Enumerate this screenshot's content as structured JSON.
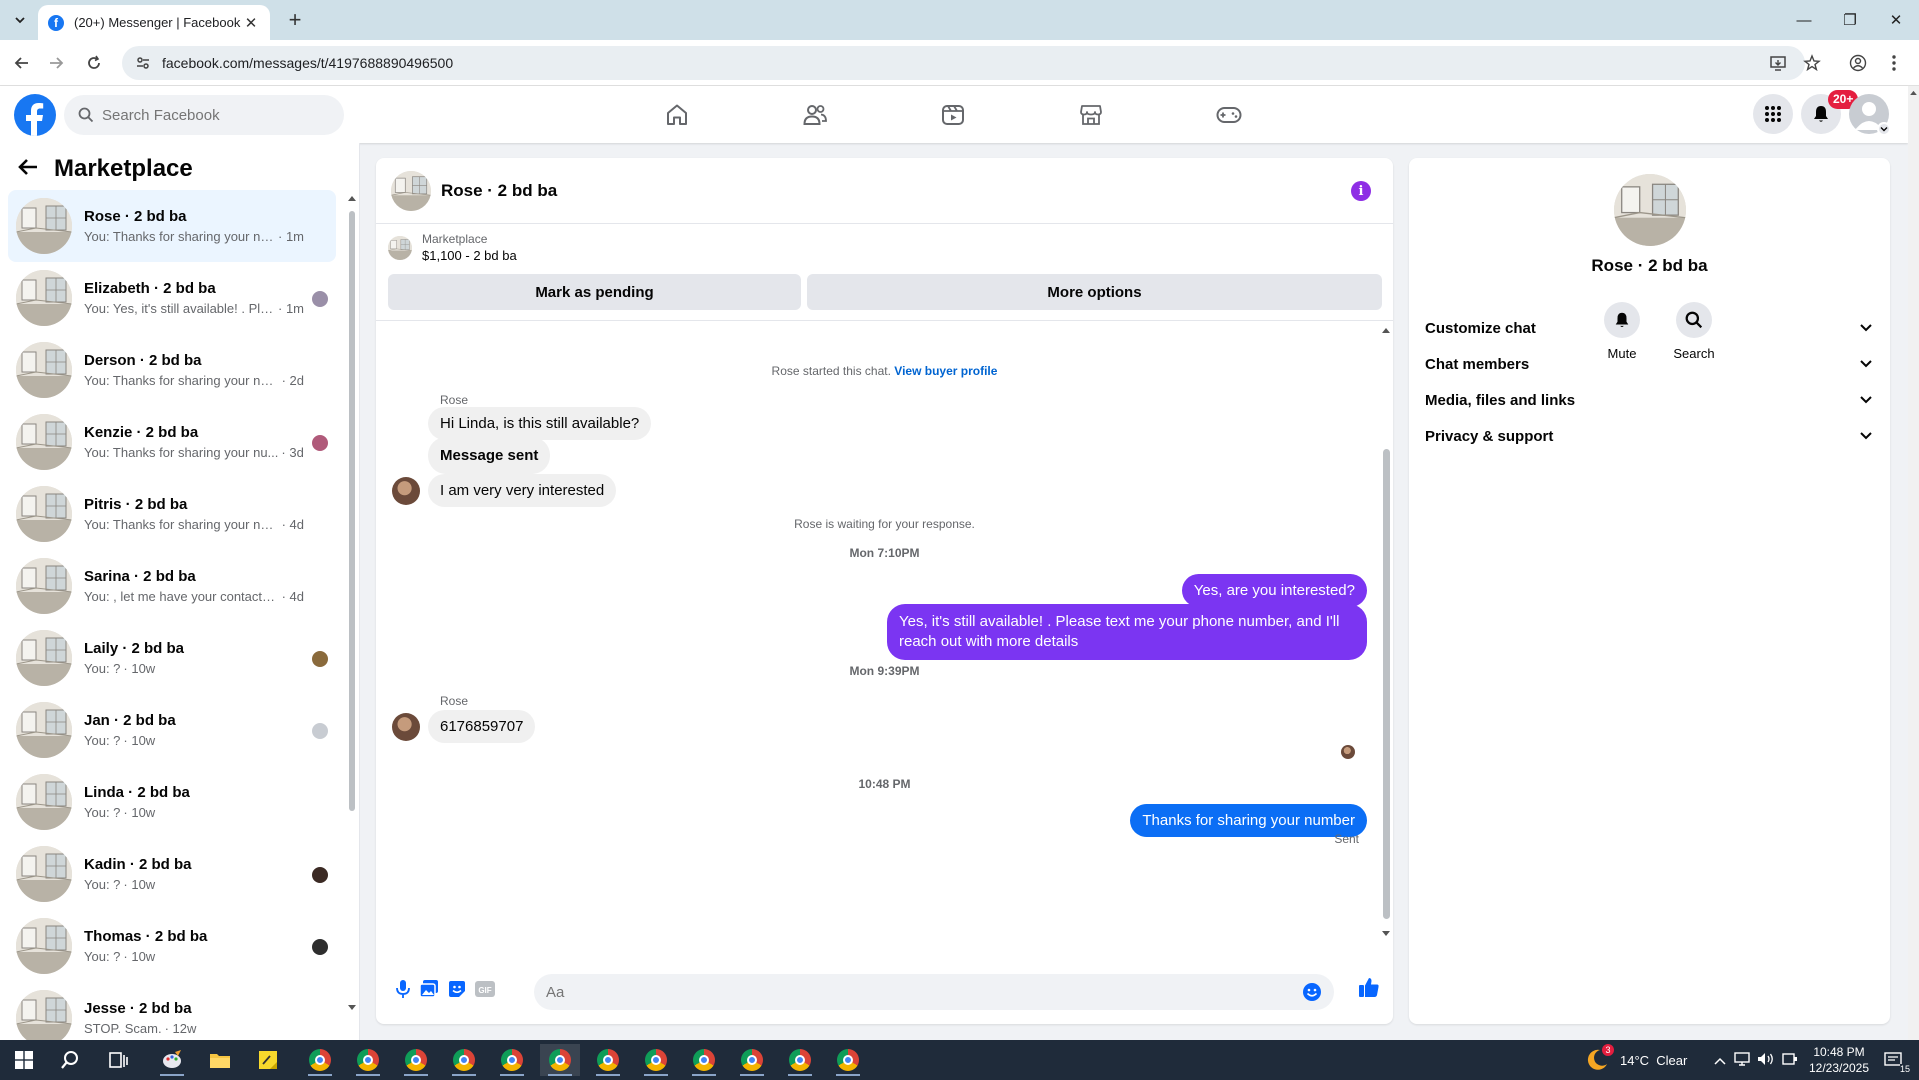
{
  "browser": {
    "tab_title": "(20+) Messenger | Facebook",
    "url": "facebook.com/messages/t/4197688890496500"
  },
  "fb_header": {
    "search_placeholder": "Search Facebook",
    "notification_count": "20+"
  },
  "left_panel": {
    "title": "Marketplace",
    "chats": [
      {
        "name": "Rose · 2 bd ba",
        "preview": "You: Thanks for sharing your num...",
        "time": "· 1m",
        "active": true,
        "mini": ""
      },
      {
        "name": "Elizabeth · 2 bd ba",
        "preview": "You: Yes, it's still available! . Plea...",
        "time": "· 1m",
        "active": false,
        "mini": "#9a8fa8"
      },
      {
        "name": "Derson · 2 bd ba",
        "preview": "You: Thanks for sharing your number",
        "time": "· 2d",
        "active": false,
        "mini": ""
      },
      {
        "name": "Kenzie · 2 bd ba",
        "preview": "You: Thanks for sharing your nu...",
        "time": "· 3d",
        "active": false,
        "mini": "#b05a7a"
      },
      {
        "name": "Pitris · 2 bd ba",
        "preview": "You: Thanks for sharing your number",
        "time": "· 4d",
        "active": false,
        "mini": ""
      },
      {
        "name": "Sarina · 2 bd ba",
        "preview": "You: , let me have your contact nu...",
        "time": "· 4d",
        "active": false,
        "mini": ""
      },
      {
        "name": "Laily · 2 bd ba",
        "preview": "You: ?",
        "time": "· 10w",
        "active": false,
        "mini": "#8a6a3c"
      },
      {
        "name": "Jan · 2 bd ba",
        "preview": "You: ?",
        "time": "· 10w",
        "active": false,
        "mini": "#c8ccd2"
      },
      {
        "name": "Linda · 2 bd ba",
        "preview": "You: ?",
        "time": "· 10w",
        "active": false,
        "mini": ""
      },
      {
        "name": "Kadin · 2 bd ba",
        "preview": "You: ?",
        "time": "· 10w",
        "active": false,
        "mini": "#3b2a24"
      },
      {
        "name": "Thomas · 2 bd ba",
        "preview": "You: ?",
        "time": "· 10w",
        "active": false,
        "mini": "#2e2e2e"
      },
      {
        "name": "Jesse · 2 bd ba",
        "preview": "STOP. Scam.",
        "time": "· 12w",
        "active": false,
        "mini": ""
      }
    ]
  },
  "conversation": {
    "title": "Rose · 2 bd ba",
    "marketplace_label": "Marketplace",
    "listing": "$1,100 - 2 bd ba",
    "mark_pending": "Mark as pending",
    "more_options": "More options",
    "started_text": "Rose started this chat.",
    "view_profile": "View buyer profile",
    "sender_name": "Rose",
    "msg_1": "Hi Linda, is this still available?",
    "msg_2": "Message sent",
    "msg_3": "I am very very interested",
    "waiting": "Rose is waiting for your response.",
    "time_1": "Mon 7:10PM",
    "out_1": "Yes, are you interested?",
    "out_2": "Yes, it's still available! . Please text me your phone number, and I'll reach out with more details",
    "time_2": "Mon 9:39PM",
    "sender_name_2": "Rose",
    "msg_4": "6176859707",
    "time_3": "10:48 PM",
    "out_3": "Thanks for sharing your number",
    "sent_status": "Sent",
    "composer_placeholder": "Aa"
  },
  "right_panel": {
    "name": "Rose · 2 bd ba",
    "mute_label": "Mute",
    "search_label": "Search",
    "sections": [
      "Customize chat",
      "Chat members",
      "Media, files and links",
      "Privacy & support"
    ]
  },
  "taskbar": {
    "weather": "14°C  Clear",
    "weather_badge": "3",
    "time": "10:48 PM",
    "date": "12/23/2025",
    "notif_count": "15"
  },
  "colors": {
    "fb_blue": "#1877f2",
    "outgoing_purple": "#7b35f2",
    "outgoing_blue": "#0b6ef5",
    "active_chat_bg": "#ebf5ff"
  }
}
